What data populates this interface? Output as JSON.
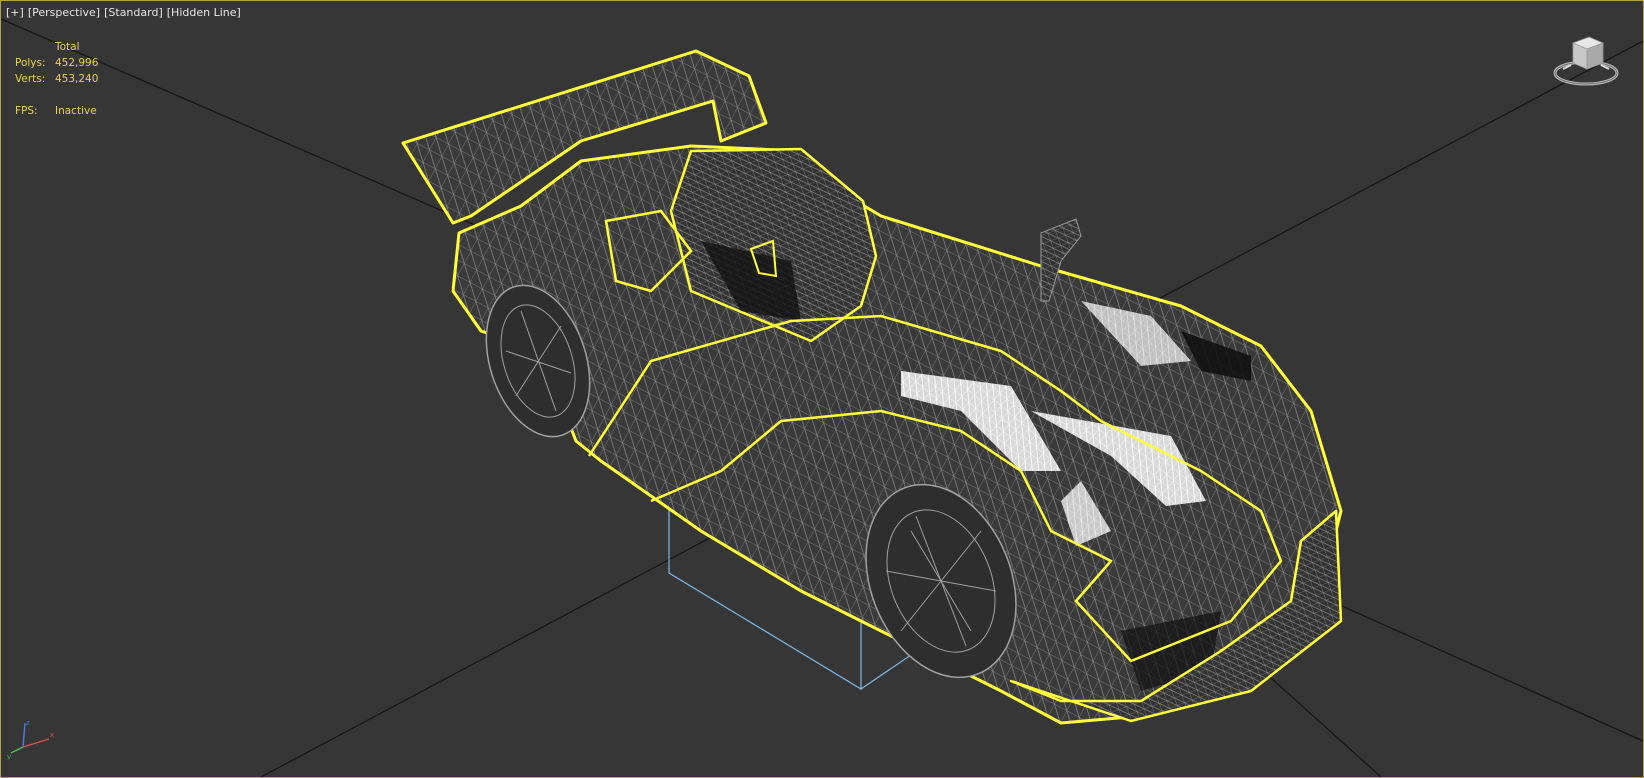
{
  "viewport": {
    "labels": [
      "[+]",
      "[Perspective]",
      "[Standard]",
      "[Hidden Line]"
    ],
    "stats": {
      "header": "Total",
      "polys_label": "Polys:",
      "polys_value": "452,996",
      "verts_label": "Verts:",
      "verts_value": "453,240",
      "fps_label": "FPS:",
      "fps_value": "Inactive"
    }
  },
  "colors": {
    "background": "#363636",
    "border": "#b8a04a",
    "selection_outline": "#ffff3a",
    "wire": "#8a8a8a",
    "bbox": "#7fb8e6",
    "stats_text": "#e8d060"
  },
  "icons": [
    "viewcube-icon",
    "axis-triad-icon"
  ],
  "scene": {
    "object": "race-car-wireframe",
    "selected": true
  }
}
